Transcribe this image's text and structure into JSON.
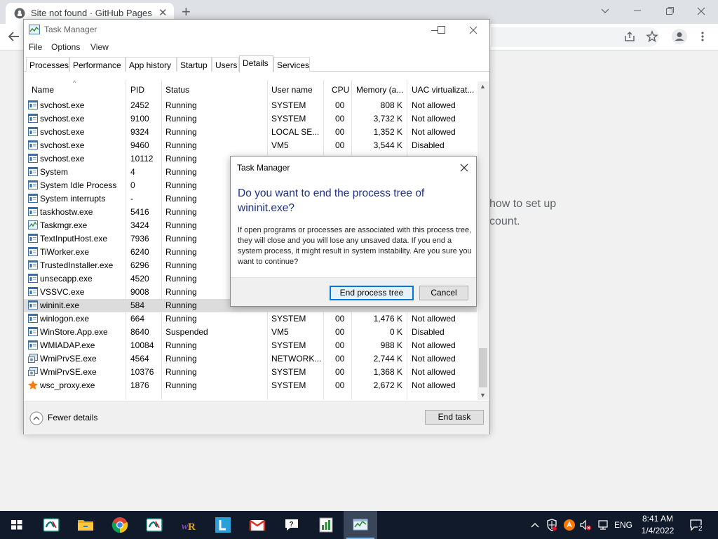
{
  "browser": {
    "tab_title": "Site not found · GitHub Pages",
    "page_text": [
      "how to set up",
      "count."
    ]
  },
  "task_manager": {
    "title": "Task Manager",
    "menu": [
      "File",
      "Options",
      "View"
    ],
    "tabs": [
      "Processes",
      "Performance",
      "App history",
      "Startup",
      "Users",
      "Details",
      "Services"
    ],
    "active_tab": "Details",
    "columns": [
      "Name",
      "PID",
      "Status",
      "User name",
      "CPU",
      "Memory (a...",
      "UAC virtualizat..."
    ],
    "rows": [
      {
        "name": "svchost.exe",
        "pid": "2452",
        "status": "Running",
        "user": "SYSTEM",
        "cpu": "00",
        "mem": "808 K",
        "uac": "Not allowed",
        "icon": "service"
      },
      {
        "name": "svchost.exe",
        "pid": "9100",
        "status": "Running",
        "user": "SYSTEM",
        "cpu": "00",
        "mem": "3,732 K",
        "uac": "Not allowed",
        "icon": "service"
      },
      {
        "name": "svchost.exe",
        "pid": "9324",
        "status": "Running",
        "user": "LOCAL SE...",
        "cpu": "00",
        "mem": "1,352 K",
        "uac": "Not allowed",
        "icon": "service"
      },
      {
        "name": "svchost.exe",
        "pid": "9460",
        "status": "Running",
        "user": "VM5",
        "cpu": "00",
        "mem": "3,544 K",
        "uac": "Disabled",
        "icon": "service"
      },
      {
        "name": "svchost.exe",
        "pid": "10112",
        "status": "Running",
        "user": "",
        "cpu": "",
        "mem": "",
        "uac": "",
        "icon": "service"
      },
      {
        "name": "System",
        "pid": "4",
        "status": "Running",
        "user": "",
        "cpu": "",
        "mem": "",
        "uac": "",
        "icon": "service"
      },
      {
        "name": "System Idle Process",
        "pid": "0",
        "status": "Running",
        "user": "",
        "cpu": "",
        "mem": "",
        "uac": "",
        "icon": "service"
      },
      {
        "name": "System interrupts",
        "pid": "-",
        "status": "Running",
        "user": "",
        "cpu": "",
        "mem": "",
        "uac": "",
        "icon": "service"
      },
      {
        "name": "taskhostw.exe",
        "pid": "5416",
        "status": "Running",
        "user": "",
        "cpu": "",
        "mem": "",
        "uac": "",
        "icon": "service"
      },
      {
        "name": "Taskmgr.exe",
        "pid": "3424",
        "status": "Running",
        "user": "",
        "cpu": "",
        "mem": "",
        "uac": "",
        "icon": "taskmgr"
      },
      {
        "name": "TextInputHost.exe",
        "pid": "7936",
        "status": "Running",
        "user": "",
        "cpu": "",
        "mem": "",
        "uac": "",
        "icon": "service"
      },
      {
        "name": "TiWorker.exe",
        "pid": "6240",
        "status": "Running",
        "user": "",
        "cpu": "",
        "mem": "",
        "uac": "",
        "icon": "service"
      },
      {
        "name": "TrustedInstaller.exe",
        "pid": "6296",
        "status": "Running",
        "user": "",
        "cpu": "",
        "mem": "",
        "uac": "",
        "icon": "service"
      },
      {
        "name": "unsecapp.exe",
        "pid": "4520",
        "status": "Running",
        "user": "",
        "cpu": "",
        "mem": "",
        "uac": "",
        "icon": "service"
      },
      {
        "name": "VSSVC.exe",
        "pid": "9008",
        "status": "Running",
        "user": "",
        "cpu": "",
        "mem": "",
        "uac": "",
        "icon": "service"
      },
      {
        "name": "wininit.exe",
        "pid": "584",
        "status": "Running",
        "user": "",
        "cpu": "",
        "mem": "",
        "uac": "",
        "icon": "service",
        "selected": true
      },
      {
        "name": "winlogon.exe",
        "pid": "664",
        "status": "Running",
        "user": "SYSTEM",
        "cpu": "00",
        "mem": "1,476 K",
        "uac": "Not allowed",
        "icon": "service"
      },
      {
        "name": "WinStore.App.exe",
        "pid": "8640",
        "status": "Suspended",
        "user": "VM5",
        "cpu": "00",
        "mem": "0 K",
        "uac": "Disabled",
        "icon": "service"
      },
      {
        "name": "WMIADAP.exe",
        "pid": "10084",
        "status": "Running",
        "user": "SYSTEM",
        "cpu": "00",
        "mem": "988 K",
        "uac": "Not allowed",
        "icon": "service"
      },
      {
        "name": "WmiPrvSE.exe",
        "pid": "4564",
        "status": "Running",
        "user": "NETWORK...",
        "cpu": "00",
        "mem": "2,744 K",
        "uac": "Not allowed",
        "icon": "wmi"
      },
      {
        "name": "WmiPrvSE.exe",
        "pid": "10376",
        "status": "Running",
        "user": "SYSTEM",
        "cpu": "00",
        "mem": "1,368 K",
        "uac": "Not allowed",
        "icon": "wmi"
      },
      {
        "name": "wsc_proxy.exe",
        "pid": "1876",
        "status": "Running",
        "user": "SYSTEM",
        "cpu": "00",
        "mem": "2,672 K",
        "uac": "Not allowed",
        "icon": "avast"
      }
    ],
    "footer": {
      "fewer_details": "Fewer details",
      "end_task": "End task"
    }
  },
  "dialog": {
    "title": "Task Manager",
    "heading": "Do you want to end the process tree of wininit.exe?",
    "body": "If open programs or processes are associated with this process tree, they will close and you will lose any unsaved data. If you end a system process, it might result in system instability. Are you sure you want to continue?",
    "primary_button": "End process tree",
    "cancel_button": "Cancel"
  },
  "taskbar": {
    "apps": [
      {
        "name": "credit-agricole",
        "icon": "ca-icon"
      },
      {
        "name": "file-explorer",
        "icon": "folder-icon"
      },
      {
        "name": "chrome",
        "icon": "chrome-icon"
      },
      {
        "name": "credit-agricole-2",
        "icon": "ca-icon"
      },
      {
        "name": "winrar",
        "icon": "winrar-icon"
      },
      {
        "name": "lexique",
        "icon": "l-icon"
      },
      {
        "name": "gmail",
        "icon": "gmail-icon"
      },
      {
        "name": "quick-assist",
        "icon": "quick-assist-icon"
      },
      {
        "name": "notepad-chart",
        "icon": "chart-app-icon"
      },
      {
        "name": "task-manager",
        "icon": "task-manager-icon",
        "active": true
      }
    ],
    "language": "ENG",
    "time": "8:41 AM",
    "date": "1/4/2022",
    "notifications": "2"
  },
  "colors": {
    "dialog_heading": "#1e3287",
    "taskbar": "#111a2b",
    "accent": "#0078d7",
    "selected_row": "#dcdcdc"
  }
}
